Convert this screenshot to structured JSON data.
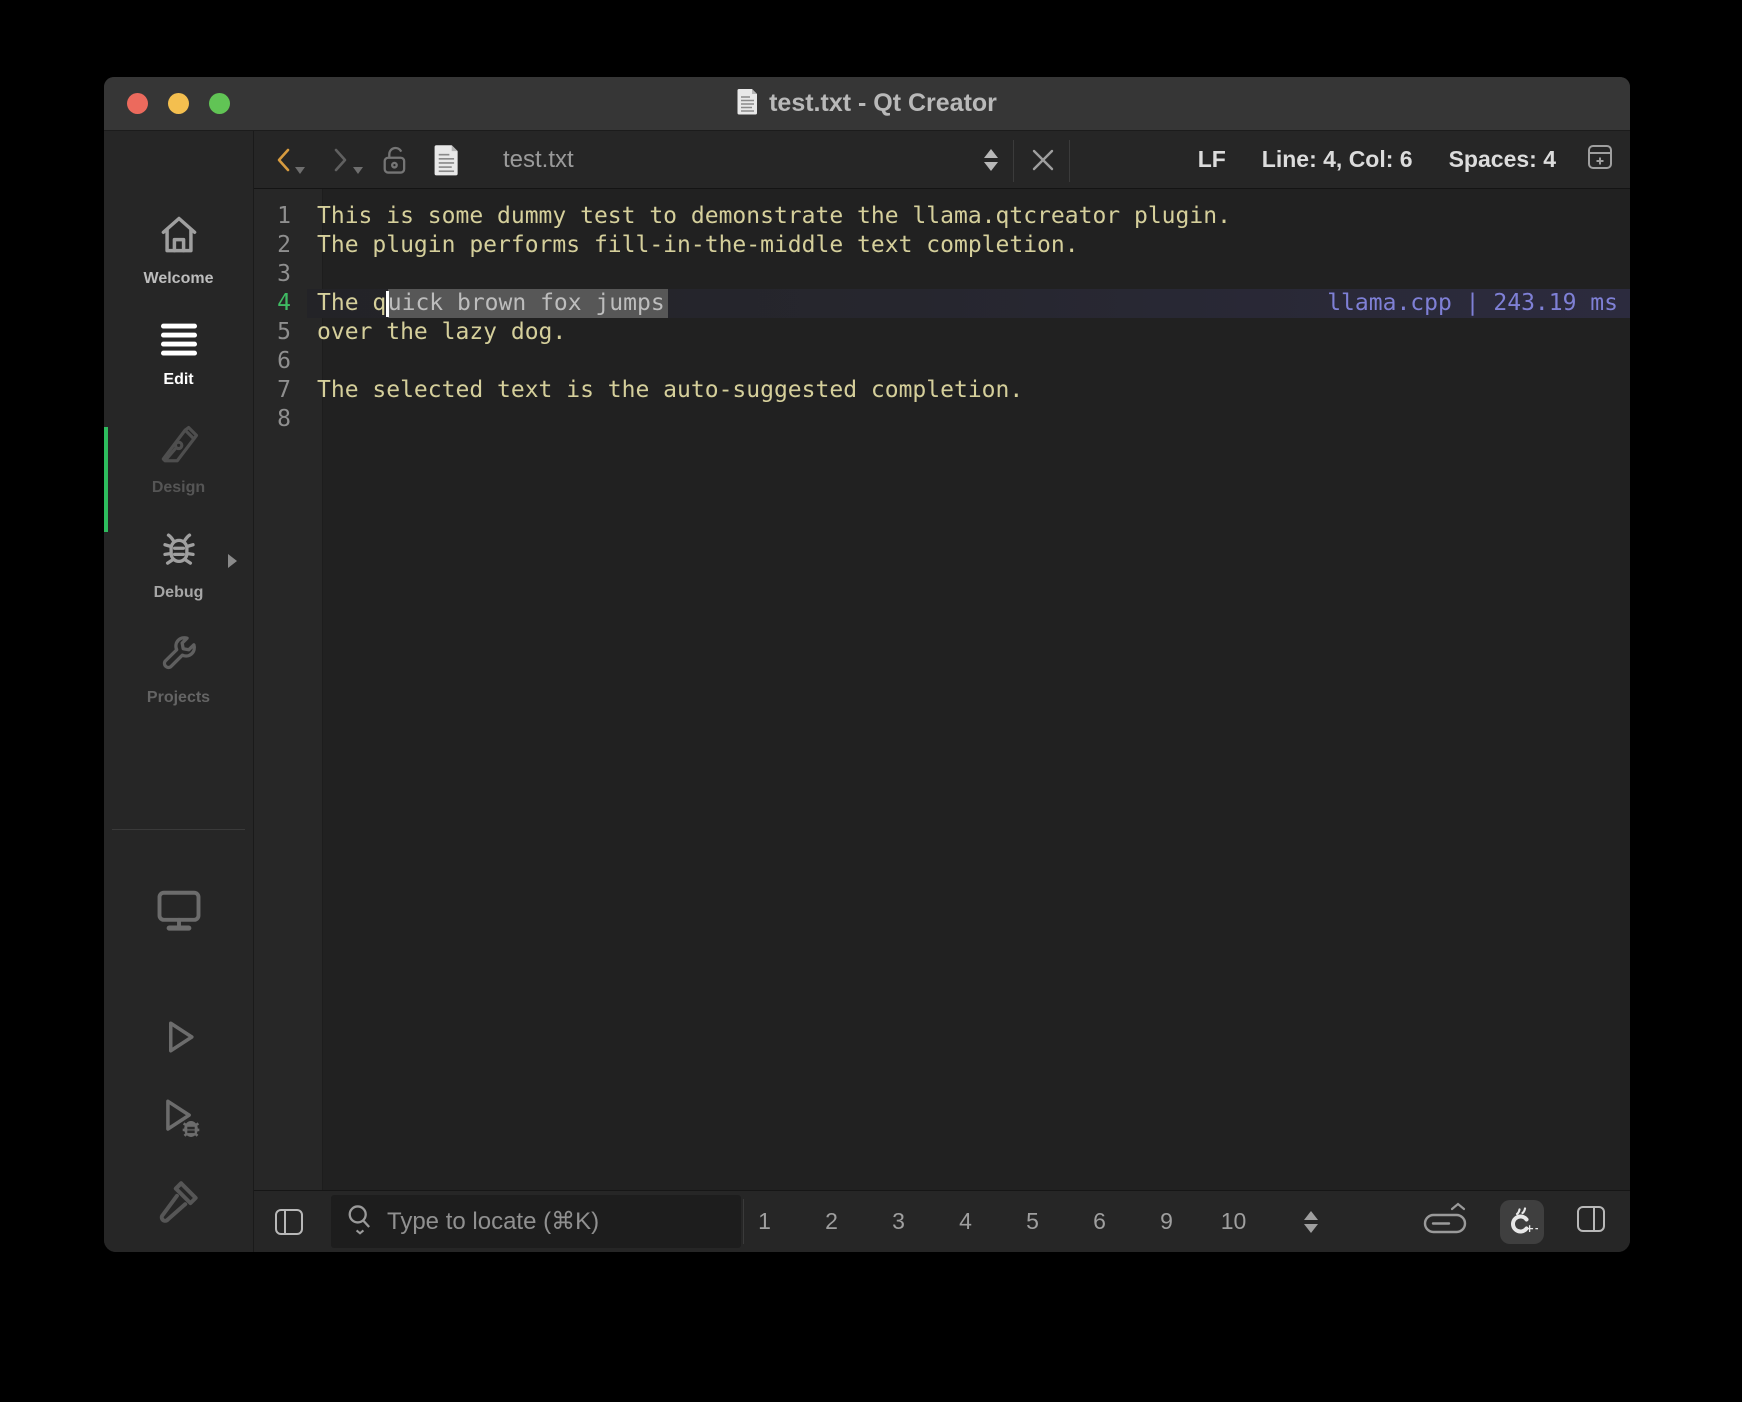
{
  "window": {
    "title": "test.txt - Qt Creator"
  },
  "toolbar": {
    "document_name": "test.txt",
    "line_ending": "LF",
    "cursor_position": "Line: 4, Col: 6",
    "indentation": "Spaces: 4"
  },
  "sidebar": {
    "modes": [
      {
        "label": "Welcome",
        "icon": "home-icon",
        "active": false
      },
      {
        "label": "Edit",
        "icon": "edit-lines-icon",
        "active": true
      },
      {
        "label": "Design",
        "icon": "pen-nib-icon",
        "active": false,
        "disabled": true
      },
      {
        "label": "Debug",
        "icon": "bug-icon",
        "active": false
      },
      {
        "label": "Projects",
        "icon": "wrench-icon",
        "active": false,
        "disabled": true
      }
    ],
    "tools": [
      "kit-selector-monitor-icon",
      "run-icon",
      "debug-run-icon",
      "build-hammer-icon"
    ]
  },
  "editor": {
    "lines": [
      {
        "number": "1",
        "text": "This is some dummy test to demonstrate the llama.qtcreator plugin."
      },
      {
        "number": "2",
        "text": "The plugin performs fill-in-the-middle text completion."
      },
      {
        "number": "3",
        "text": ""
      },
      {
        "number": "4",
        "text": "The q"
      },
      {
        "number": "5",
        "text": "over the lazy dog."
      },
      {
        "number": "6",
        "text": ""
      },
      {
        "number": "7",
        "text": "The selected text is the auto-suggested completion."
      },
      {
        "number": "8",
        "text": ""
      }
    ],
    "completion": {
      "line": 4,
      "prefix": "The q",
      "suggestion": "uick brown fox jumps",
      "annotation": "llama.cpp | 243.19 ms"
    }
  },
  "statusbar": {
    "locator_placeholder": "Type to locate (⌘K)",
    "pane_buttons": [
      "1",
      "2",
      "3",
      "4",
      "5",
      "6",
      "9",
      "10"
    ]
  },
  "colors": {
    "accent_green": "#2ebd5e",
    "code_text": "#d5cf9b",
    "completion_annotation": "#7f80d6",
    "current_line_highlight": "#2c2b3e",
    "suggestion_selection": "#575757",
    "traffic_red": "#ec6a5d",
    "traffic_yellow": "#f4bf4f",
    "traffic_green": "#61c455"
  }
}
